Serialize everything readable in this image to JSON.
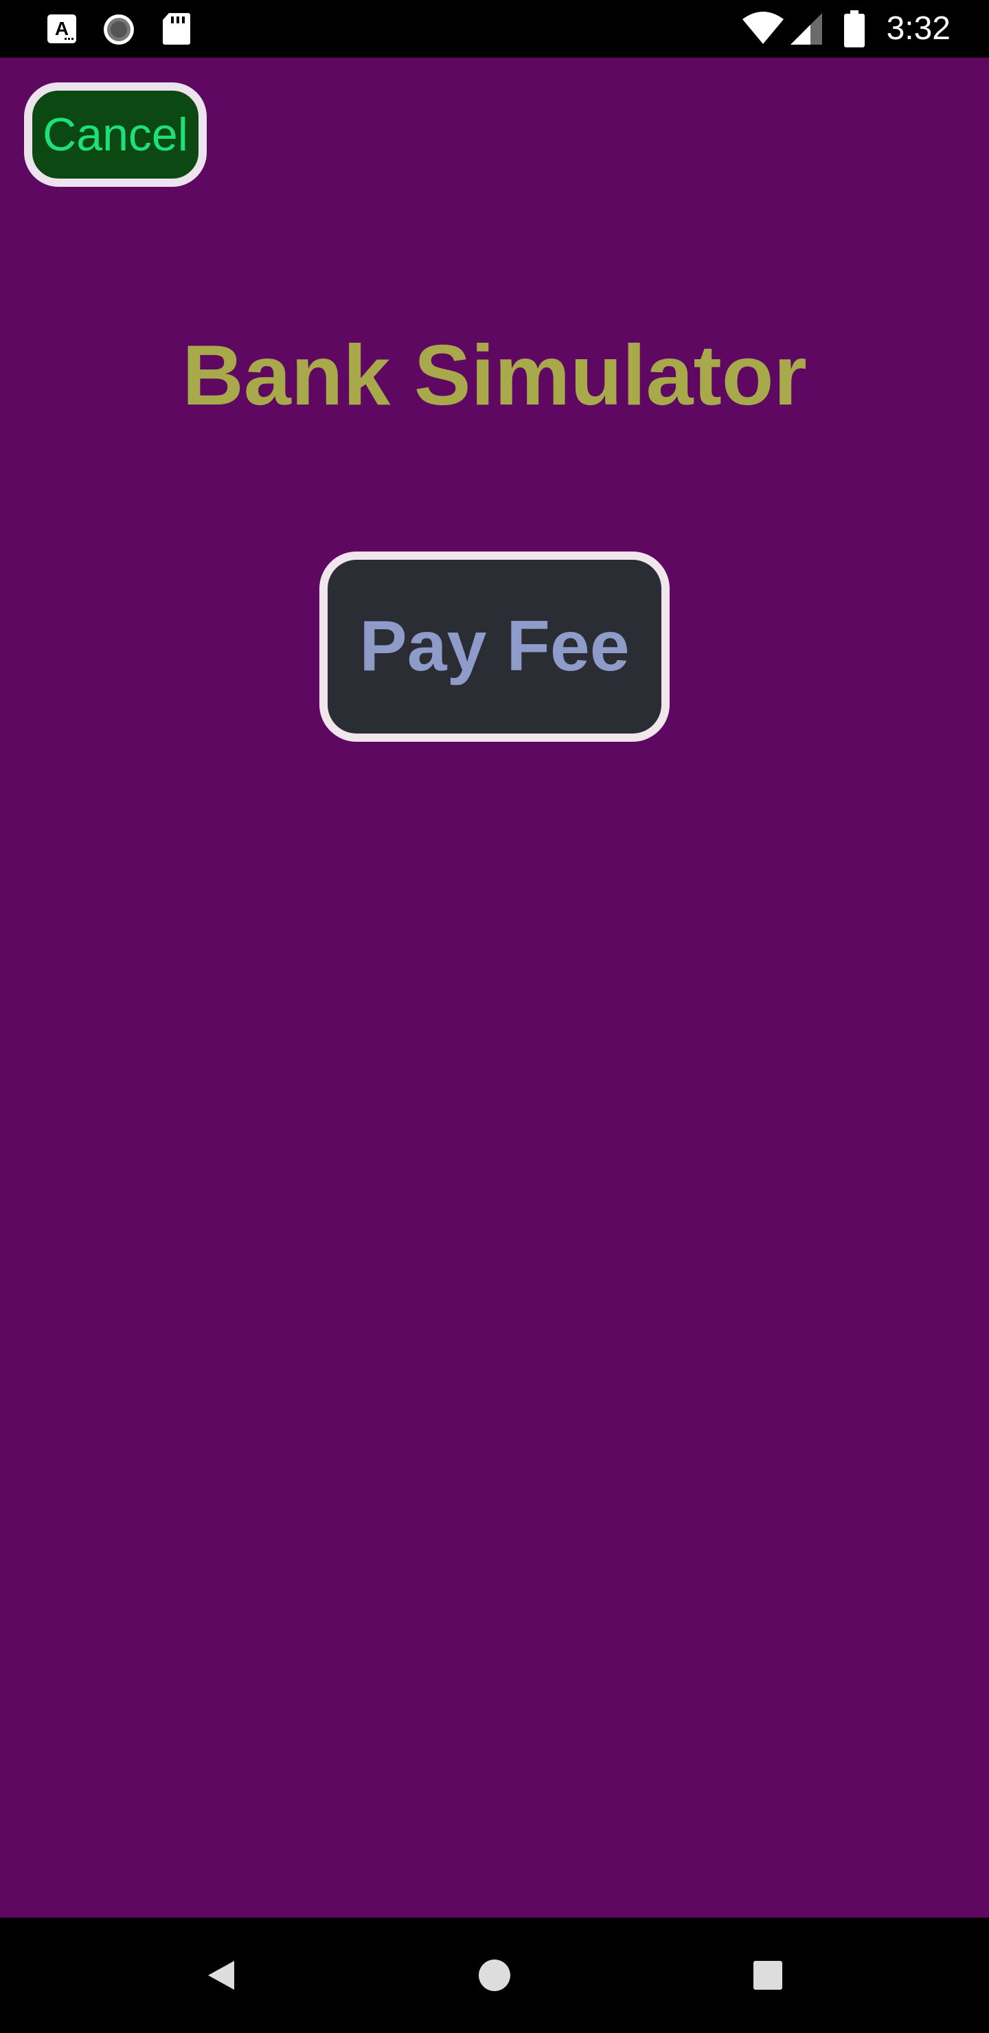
{
  "status_bar": {
    "time": "3:32",
    "left_icons": [
      "font-a-icon",
      "sync-spinner-icon",
      "sd-card-icon"
    ],
    "right_icons": [
      "wifi-icon",
      "cell-signal-icon",
      "battery-icon"
    ]
  },
  "screen": {
    "background_color": "#5e0861",
    "cancel_label": "Cancel",
    "title": "Bank Simulator",
    "pay_fee_label": "Pay Fee"
  },
  "colors": {
    "cancel_bg": "#0c4812",
    "cancel_text": "#1ee07a",
    "title_text": "#a7a94a",
    "pay_fee_bg": "#2a2d33",
    "pay_fee_text": "#8f9bc9"
  },
  "nav_bar": {
    "buttons": [
      "back-icon",
      "home-icon",
      "recents-icon"
    ]
  }
}
